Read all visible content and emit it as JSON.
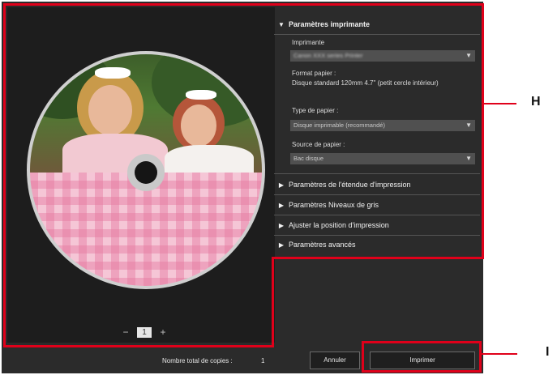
{
  "printer_settings": {
    "header": "Paramètres imprimante",
    "printer_label": "Imprimante",
    "printer_value": "Canon XXX series Printer",
    "paper_format_label": "Format papier :",
    "paper_format_value": "Disque standard 120mm 4.7\" (petit cercle intérieur)",
    "paper_type_label": "Type de papier :",
    "paper_type_value": "Disque imprimable (recommandé)",
    "paper_source_label": "Source de papier :",
    "paper_source_value": "Bac disque"
  },
  "collapsed_sections": [
    "Paramètres de l'étendue d'impression",
    "Paramètres Niveaux de gris",
    "Ajuster la position d'impression",
    "Paramètres avancés"
  ],
  "pager": {
    "prev": "−",
    "page": "1",
    "next": "+"
  },
  "footer": {
    "copies_label": "Nombre total de copies :",
    "copies_value": "1",
    "cancel_label": "Annuler",
    "print_label": "Imprimer"
  },
  "callouts": {
    "h": "H",
    "i": "I"
  },
  "colors": {
    "highlight": "#e0001a",
    "panel_bg": "#2b2b2b"
  }
}
